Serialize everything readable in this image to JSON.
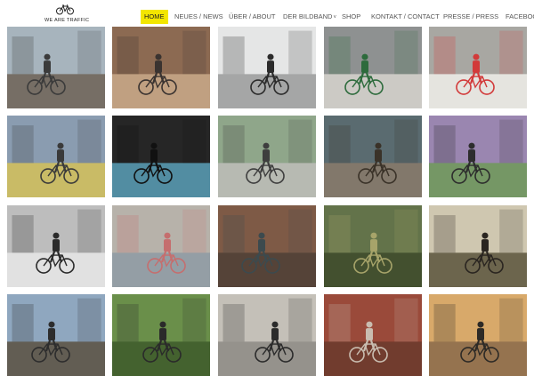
{
  "brand": {
    "name": "WE ARE TRAFFIC"
  },
  "nav": {
    "items": [
      {
        "label": "HOME",
        "active": true
      },
      {
        "label": "NEUES / NEWS",
        "active": false
      },
      {
        "label": "ÜBER / ABOUT",
        "active": false
      },
      {
        "label": "DER BILDBAND",
        "active": false,
        "dropdown": true
      },
      {
        "label": "SHOP",
        "active": false
      },
      {
        "label": "KONTAKT / CONTACT",
        "active": false
      },
      {
        "label": "PRESSE / PRESS",
        "active": false
      },
      {
        "label": "FACEBOOK",
        "active": false
      }
    ],
    "accent_color": "#f3e600"
  },
  "gallery": {
    "tiles": [
      {
        "scene": "city-street-with-tv-tower",
        "colors": [
          "#a7b4bd",
          "#6d6256",
          "#3b3b3b"
        ]
      },
      {
        "scene": "rider-on-bridge-stairs",
        "colors": [
          "#8c6a52",
          "#c9a98a",
          "#3a3330"
        ]
      },
      {
        "scene": "trick-rider-jump",
        "colors": [
          "#e5e6e6",
          "#9a9a9a",
          "#2b2b2b"
        ]
      },
      {
        "scene": "rider-graffiti-wall",
        "colors": [
          "#8e9191",
          "#d7d4ce",
          "#2d6b3c"
        ]
      },
      {
        "scene": "graffiti-sidewalk-rider",
        "colors": [
          "#a8a7a2",
          "#f0eeea",
          "#d23a3a"
        ]
      },
      {
        "scene": "rider-colorful-mural",
        "colors": [
          "#8a9cb0",
          "#d3c159",
          "#3a3a3a"
        ]
      },
      {
        "scene": "man-lifting-bike-dark",
        "colors": [
          "#262626",
          "#5aa0b8",
          "#111111"
        ]
      },
      {
        "scene": "rider-sitting-park",
        "colors": [
          "#8fa68a",
          "#bebdb9",
          "#3e3e3e"
        ]
      },
      {
        "scene": "rider-on-rail-tracks",
        "colors": [
          "#5a6b70",
          "#8a7a6a",
          "#3a3228"
        ]
      },
      {
        "scene": "man-with-bike-lilac",
        "colors": [
          "#9a86b0",
          "#6f9a58",
          "#2d2d2d"
        ]
      },
      {
        "scene": "silhouette-rider-station",
        "colors": [
          "#bdbdbd",
          "#e8e8e8",
          "#2a2a2a"
        ]
      },
      {
        "scene": "rider-graffiti-building",
        "colors": [
          "#b7b2aa",
          "#8e9aa4",
          "#c56e6e"
        ]
      },
      {
        "scene": "canal-brick-building",
        "colors": [
          "#7e5a46",
          "#4d3f36",
          "#3c4a4e"
        ]
      },
      {
        "scene": "forest-rider-splash",
        "colors": [
          "#63734a",
          "#3d4a2a",
          "#a7a46a"
        ]
      },
      {
        "scene": "rider-sunlit-trees",
        "colors": [
          "#cfc7b0",
          "#5b533c",
          "#2a2520"
        ]
      },
      {
        "scene": "man-sitting-harbor",
        "colors": [
          "#8fa7bf",
          "#5a5040",
          "#2d2d2d"
        ]
      },
      {
        "scene": "man-reclined-bike",
        "colors": [
          "#6a8f4a",
          "#3d5a2a",
          "#2a2a2a"
        ]
      },
      {
        "scene": "man-cargo-bike-street",
        "colors": [
          "#c4c0b8",
          "#8d8a84",
          "#2b2b2b"
        ]
      },
      {
        "scene": "brick-building",
        "colors": [
          "#9a4a3a",
          "#6a3a2d",
          "#c9bdb0"
        ]
      },
      {
        "scene": "rider-sunlit-room",
        "colors": [
          "#d8a96a",
          "#8a6a4a",
          "#2d2a26"
        ]
      }
    ]
  }
}
